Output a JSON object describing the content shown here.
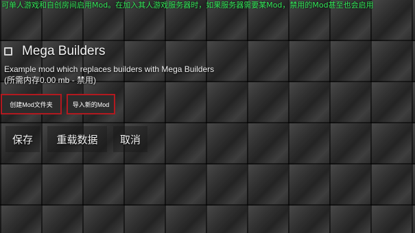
{
  "notice": "可单人游戏和自创房间启用Mod。在加入其人游戏服务器时，如果服务器需要某Mod，禁用的Mod甚至也会启用",
  "mod": {
    "title": "Mega Builders",
    "description": "Example mod which replaces builders with Mega Builders",
    "memory": "(所需内存0.00 mb - 禁用)",
    "enabled": false
  },
  "buttons": {
    "create_folder": "创建Mod文件夹",
    "import_mod": "导入新的Mod",
    "save": "保存",
    "reload": "重载数据",
    "cancel": "取消"
  },
  "colors": {
    "notice_text": "#35e85a",
    "highlight_border": "#b3191f"
  }
}
